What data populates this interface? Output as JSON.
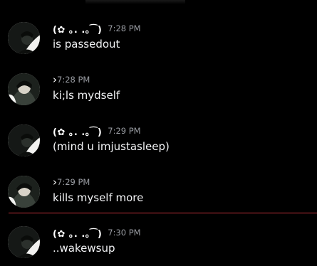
{
  "messages": [
    {
      "username": "(✿ ｡. .｡ ͡  )",
      "time": "7:28 PM",
      "text": "is passedout"
    },
    {
      "username": "",
      "chevron": "›",
      "time": "7:28 PM",
      "text": "ki;ls mydself"
    },
    {
      "username": "(✿ ｡. .｡ ͡  )",
      "time": "7:29 PM",
      "text": "(mind u imjustasleep)"
    },
    {
      "username": "",
      "chevron": "›",
      "time": "7:29 PM",
      "text": "kills myself more"
    },
    {
      "username": "(✿ ｡. .｡ ͡  )",
      "time": "7:30 PM",
      "text": "..wakewsup"
    }
  ],
  "colors": {
    "background": "#000000",
    "text": "#f2f3f5",
    "timestamp": "#9a9da3",
    "new_messages_divider": "#c3313a"
  }
}
